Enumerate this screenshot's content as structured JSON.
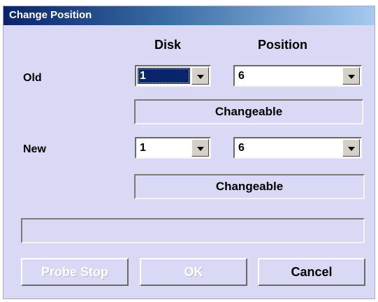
{
  "window": {
    "title": "Change Position"
  },
  "headers": {
    "disk": "Disk",
    "position": "Position"
  },
  "old": {
    "label": "Old",
    "disk": "1",
    "position": "6",
    "status": "Changeable"
  },
  "new": {
    "label": "New",
    "disk": "1",
    "position": "6",
    "status": "Changeable"
  },
  "message": "",
  "buttons": {
    "probe_stop": "Probe Stop",
    "ok": "OK",
    "cancel": "Cancel"
  }
}
